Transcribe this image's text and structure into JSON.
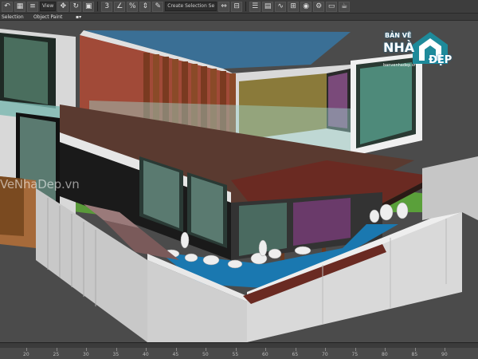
{
  "toolbar": {
    "view_dropdown": "View",
    "selection_set": "Create Selection Se"
  },
  "subbar": {
    "selection_label": "Selection",
    "object_paint_label": "Object Paint"
  },
  "viewport": {
    "watermark": "VeNhaDep.vn"
  },
  "logo": {
    "line1": "BẢN VẼ",
    "line2": "NHÀ",
    "line3": "ĐẸP",
    "url": "banvenhadep.vn"
  },
  "timeline": {
    "ticks": [
      "20",
      "25",
      "30",
      "35",
      "40",
      "45",
      "50",
      "55",
      "60",
      "65",
      "70",
      "75",
      "80",
      "85",
      "90"
    ]
  }
}
